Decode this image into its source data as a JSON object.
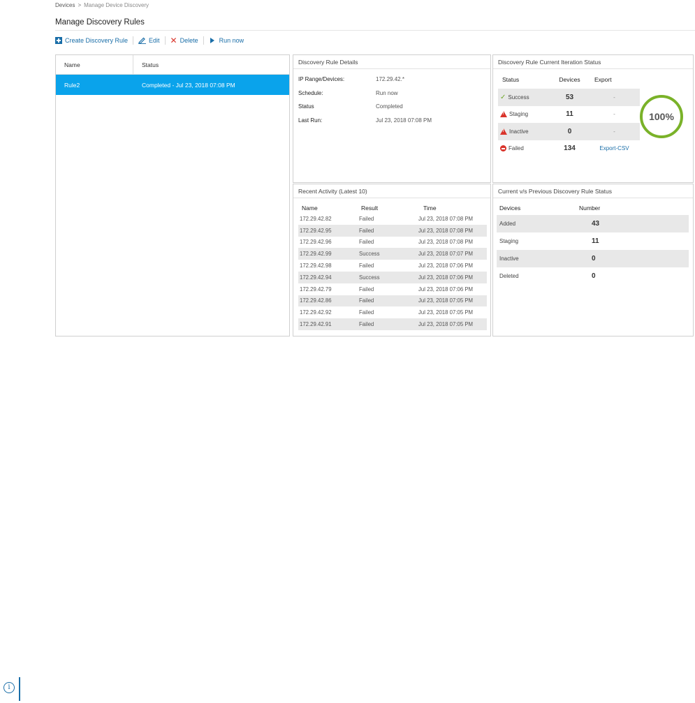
{
  "breadcrumb": {
    "root": "Devices",
    "separator": ">",
    "current": "Manage Device Discovery"
  },
  "page": {
    "title": "Manage Discovery Rules"
  },
  "toolbar": {
    "create_label": "Create Discovery Rule",
    "edit_label": "Edit",
    "delete_label": "Delete",
    "run_label": "Run now"
  },
  "rules_table": {
    "headers": {
      "name": "Name",
      "status": "Status"
    },
    "rows": [
      {
        "name": "Rule2",
        "status": "Completed - Jul 23, 2018 07:08 PM",
        "selected": true
      }
    ]
  },
  "details": {
    "title": "Discovery Rule Details",
    "rows": [
      {
        "label": "IP Range/Devices:",
        "value": "172.29.42.*"
      },
      {
        "label": "Schedule:",
        "value": "Run now"
      },
      {
        "label": "Status",
        "value": "Completed"
      },
      {
        "label": "Last Run:",
        "value": "Jul 23, 2018 07:08 PM"
      }
    ]
  },
  "iteration": {
    "title": "Discovery Rule Current Iteration Status",
    "headers": {
      "status": "Status",
      "devices": "Devices",
      "export": "Export"
    },
    "rows": [
      {
        "status": "Success",
        "icon": "check-icon",
        "devices": "53",
        "export": "-"
      },
      {
        "status": "Staging",
        "icon": "warning-icon",
        "devices": "11",
        "export": "-"
      },
      {
        "status": "Inactive",
        "icon": "warning-icon",
        "devices": "0",
        "export": "-"
      },
      {
        "status": "Failed",
        "icon": "stop-icon",
        "devices": "134",
        "export": "Export-CSV"
      }
    ],
    "progress_label": "100%",
    "progress_value": 1.0,
    "progress_color": "#7ab229"
  },
  "recent": {
    "title": "Recent Activity (Latest 10)",
    "headers": {
      "name": "Name",
      "result": "Result",
      "time": "Time"
    },
    "rows": [
      {
        "name": "172.29.42.82",
        "result": "Failed",
        "time": "Jul 23, 2018 07:08 PM"
      },
      {
        "name": "172.29.42.95",
        "result": "Failed",
        "time": "Jul 23, 2018 07:08 PM"
      },
      {
        "name": "172.29.42.96",
        "result": "Failed",
        "time": "Jul 23, 2018 07:08 PM"
      },
      {
        "name": "172.29.42.99",
        "result": "Success",
        "time": "Jul 23, 2018 07:07 PM"
      },
      {
        "name": "172.29.42.98",
        "result": "Failed",
        "time": "Jul 23, 2018 07:06 PM"
      },
      {
        "name": "172.29.42.94",
        "result": "Success",
        "time": "Jul 23, 2018 07:06 PM"
      },
      {
        "name": "172.29.42.79",
        "result": "Failed",
        "time": "Jul 23, 2018 07:06 PM"
      },
      {
        "name": "172.29.42.86",
        "result": "Failed",
        "time": "Jul 23, 2018 07:05 PM"
      },
      {
        "name": "172.29.42.92",
        "result": "Failed",
        "time": "Jul 23, 2018 07:05 PM"
      },
      {
        "name": "172.29.42.91",
        "result": "Failed",
        "time": "Jul 23, 2018 07:05 PM"
      }
    ]
  },
  "compare": {
    "title": "Current v/s Previous Discovery Rule Status",
    "headers": {
      "devices": "Devices",
      "number": "Number"
    },
    "rows": [
      {
        "label": "Added",
        "value": "43"
      },
      {
        "label": "Staging",
        "value": "11"
      },
      {
        "label": "Inactive",
        "value": "0"
      },
      {
        "label": "Deleted",
        "value": "0"
      }
    ]
  },
  "colors": {
    "accent": "#1a6ea8",
    "selected_row": "#0aa3eb",
    "error": "#d9342b",
    "success": "#6fa82a"
  },
  "footer": {
    "icon": "info-icon",
    "glyph": "i"
  }
}
